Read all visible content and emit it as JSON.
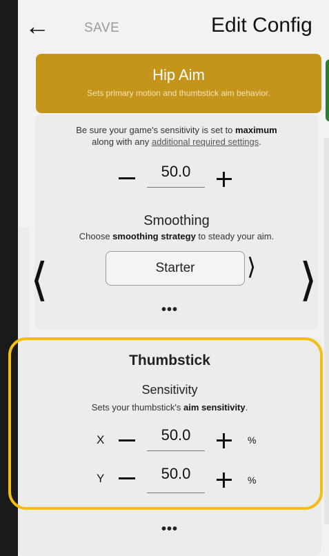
{
  "header": {
    "back_icon": "arrow-left-icon",
    "save_label": "SAVE",
    "title": "Edit Config"
  },
  "hip_aim": {
    "title": "Hip Aim",
    "subtitle": "Sets primary motion and thumbstick aim behavior.",
    "color": "#c4951a"
  },
  "sensitivity": {
    "note_prefix": "Be sure your game's sensitivity is set to",
    "note_bold": "maximum",
    "note_mid": "along with any",
    "note_link": "additional required settings",
    "note_end": ".",
    "value": "50.0"
  },
  "smoothing": {
    "title": "Smoothing",
    "desc_prefix": "Choose",
    "desc_bold": "smoothing strategy",
    "desc_suffix": "to steady your aim.",
    "selected": "Starter",
    "more": "•••"
  },
  "thumbstick": {
    "title": "Thumbstick",
    "sensitivity_title": "Sensitivity",
    "desc_prefix": "Sets your thumbstick's",
    "desc_bold": "aim sensitivity",
    "desc_suffix": ".",
    "x_label": "X",
    "x_value": "50.0",
    "y_label": "Y",
    "y_value": "50.0",
    "unit": "%",
    "more": "•••",
    "highlight_color": "#f4bd12"
  }
}
